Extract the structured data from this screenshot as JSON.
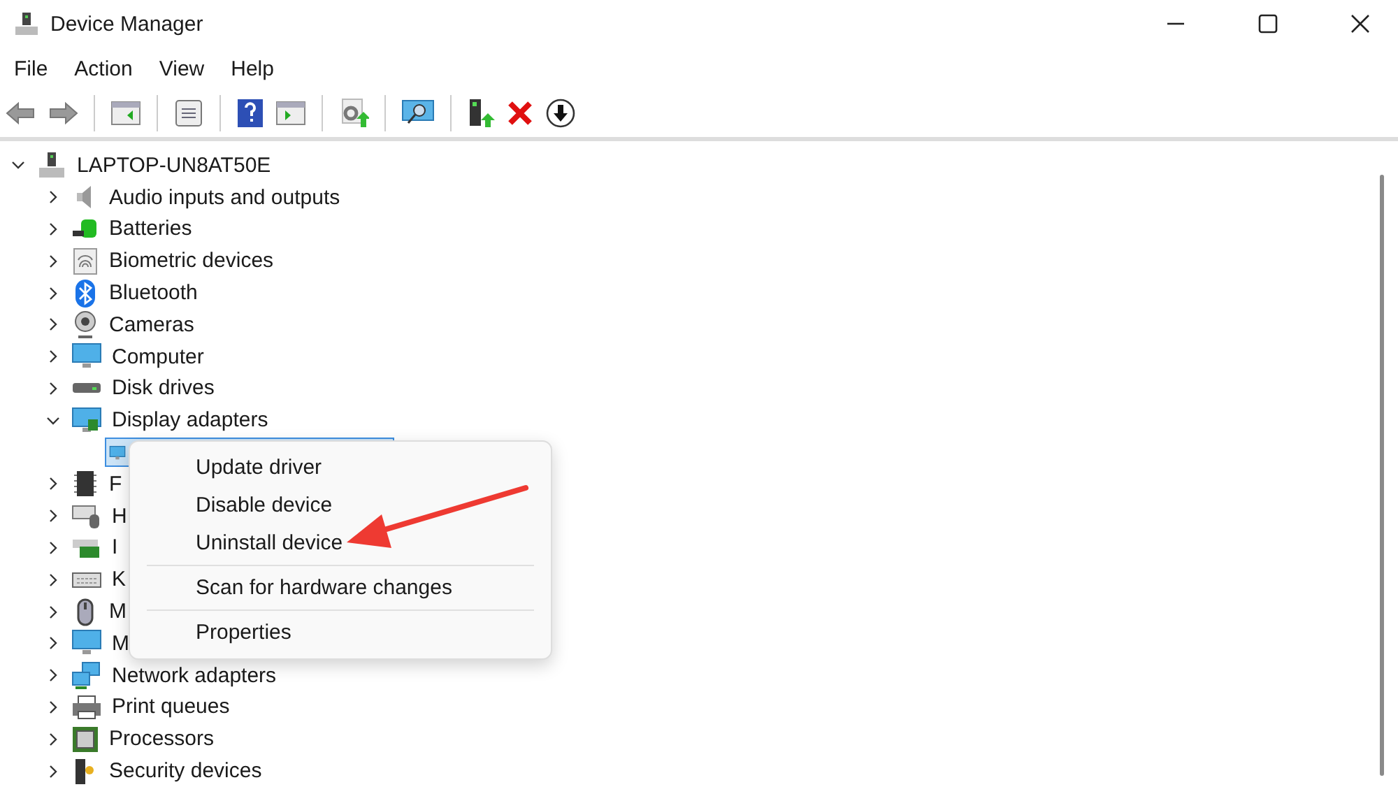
{
  "window": {
    "title": "Device Manager"
  },
  "menu_bar": [
    "File",
    "Action",
    "View",
    "Help"
  ],
  "tree": {
    "label": "LAPTOP-UN8AT50E",
    "expanded": true,
    "children": [
      {
        "label": "Audio inputs and outputs",
        "expanded": false
      },
      {
        "label": "Batteries",
        "expanded": false
      },
      {
        "label": "Biometric devices",
        "expanded": false
      },
      {
        "label": "Bluetooth",
        "expanded": false
      },
      {
        "label": "Cameras",
        "expanded": false
      },
      {
        "label": "Computer",
        "expanded": false
      },
      {
        "label": "Disk drives",
        "expanded": false
      },
      {
        "label": "Display adapters",
        "expanded": true,
        "children": [
          {
            "selected": true
          }
        ]
      },
      {
        "label": "F",
        "expanded": false
      },
      {
        "label": "H",
        "expanded": false
      },
      {
        "label": "I",
        "expanded": false
      },
      {
        "label": "K",
        "expanded": false
      },
      {
        "label": "M",
        "expanded": false
      },
      {
        "label": "M",
        "expanded": false
      },
      {
        "label": "Network adapters",
        "expanded": false
      },
      {
        "label": "Print queues",
        "expanded": false
      },
      {
        "label": "Processors",
        "expanded": false
      },
      {
        "label": "Security devices",
        "expanded": false
      }
    ]
  },
  "context_menu": {
    "sections": [
      [
        "Update driver",
        "Disable device",
        "Uninstall device"
      ],
      [
        "Scan for hardware changes"
      ],
      [
        "Properties"
      ]
    ]
  }
}
